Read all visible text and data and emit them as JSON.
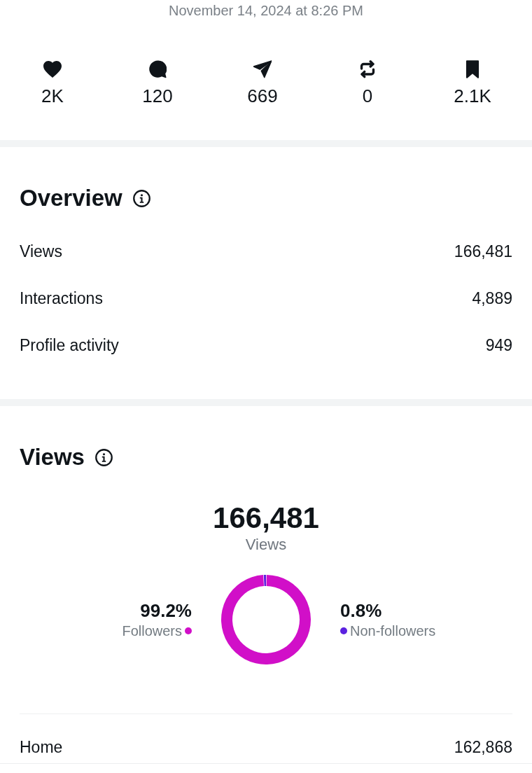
{
  "date": "November 14, 2024 at 8:26 PM",
  "stats": [
    {
      "kind": "heart",
      "value": "2K"
    },
    {
      "kind": "comment",
      "value": "120"
    },
    {
      "kind": "send",
      "value": "669"
    },
    {
      "kind": "repost",
      "value": "0"
    },
    {
      "kind": "bookmark",
      "value": "2.1K"
    }
  ],
  "overview": {
    "title": "Overview",
    "rows": [
      {
        "label": "Views",
        "value": "166,481"
      },
      {
        "label": "Interactions",
        "value": "4,889"
      },
      {
        "label": "Profile activity",
        "value": "949"
      }
    ]
  },
  "views": {
    "title": "Views",
    "total": "166,481",
    "total_label": "Views",
    "legend": [
      {
        "value": "99.2%",
        "color": "#d10fc8"
      },
      {
        "value": "0.8%",
        "color": "#5b21e0"
      }
    ],
    "chart_data": {
      "type": "donut",
      "categories": [
        "Followers",
        "Non-followers"
      ],
      "values": [
        99.2,
        0.8
      ]
    },
    "rows": [
      {
        "label": "Home",
        "value": "162,868"
      }
    ]
  }
}
